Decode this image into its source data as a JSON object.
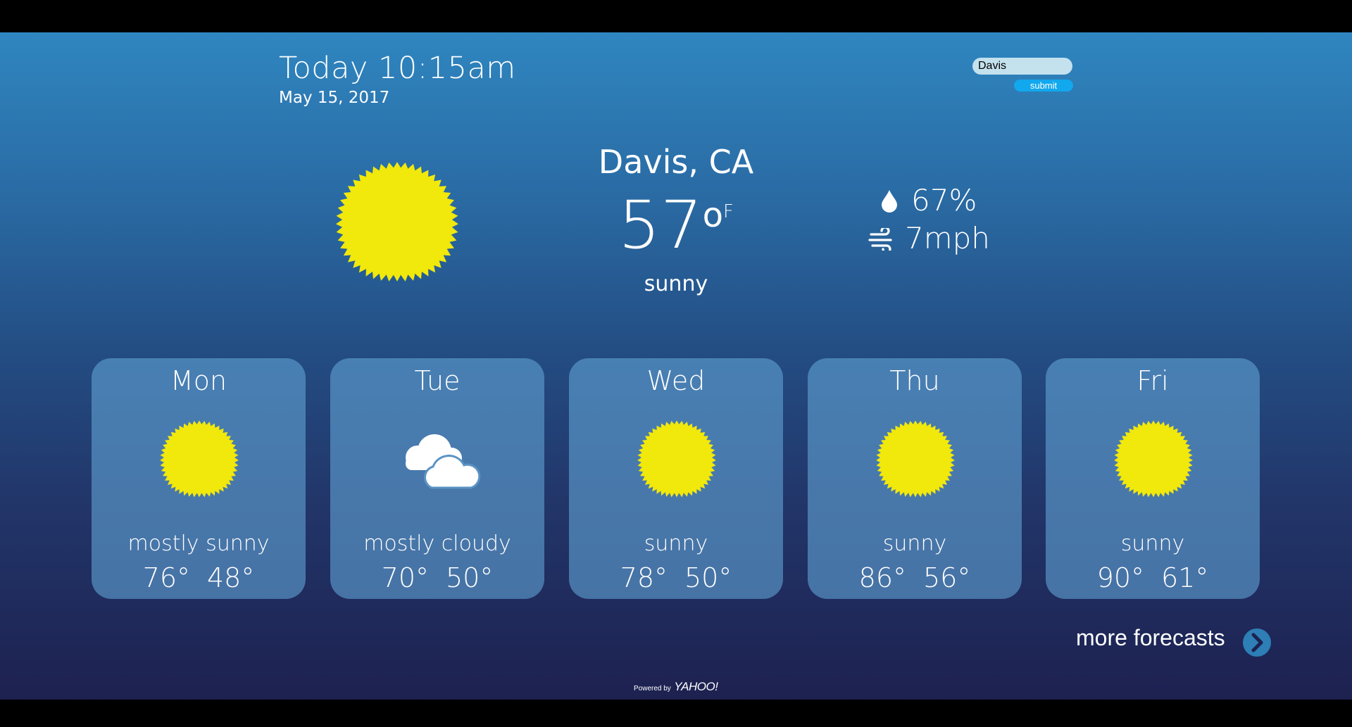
{
  "header": {
    "time": "Today 10:15am",
    "date": "May 15, 2017"
  },
  "search": {
    "value": "Davis",
    "submit_label": "submit"
  },
  "current": {
    "location": "Davis, CA",
    "temperature": "57",
    "degree_symbol": "o",
    "unit": "F",
    "condition": "sunny",
    "icon": "sun-icon",
    "humidity": "67%",
    "humidity_icon": "droplet-icon",
    "wind": "7mph",
    "wind_icon": "wind-icon"
  },
  "forecast": [
    {
      "day": "Mon",
      "icon": "sun-icon",
      "condition": "mostly sunny",
      "high": "76°",
      "low": "48°"
    },
    {
      "day": "Tue",
      "icon": "cloud-icon",
      "condition": "mostly cloudy",
      "high": "70°",
      "low": "50°"
    },
    {
      "day": "Wed",
      "icon": "sun-icon",
      "condition": "sunny",
      "high": "78°",
      "low": "50°"
    },
    {
      "day": "Thu",
      "icon": "sun-icon",
      "condition": "sunny",
      "high": "86°",
      "low": "56°"
    },
    {
      "day": "Fri",
      "icon": "sun-icon",
      "condition": "sunny",
      "high": "90°",
      "low": "61°"
    }
  ],
  "more_forecasts": {
    "label": "more forecasts",
    "icon": "chevron-right-icon"
  },
  "footer": {
    "powered_prefix": "Powered by",
    "brand": "YAHOO!"
  },
  "colors": {
    "sun": "#f1e80c",
    "accent_button": "#11a8ee",
    "arrow_button": "#2d7fb6",
    "card": "#5fa0d2"
  }
}
